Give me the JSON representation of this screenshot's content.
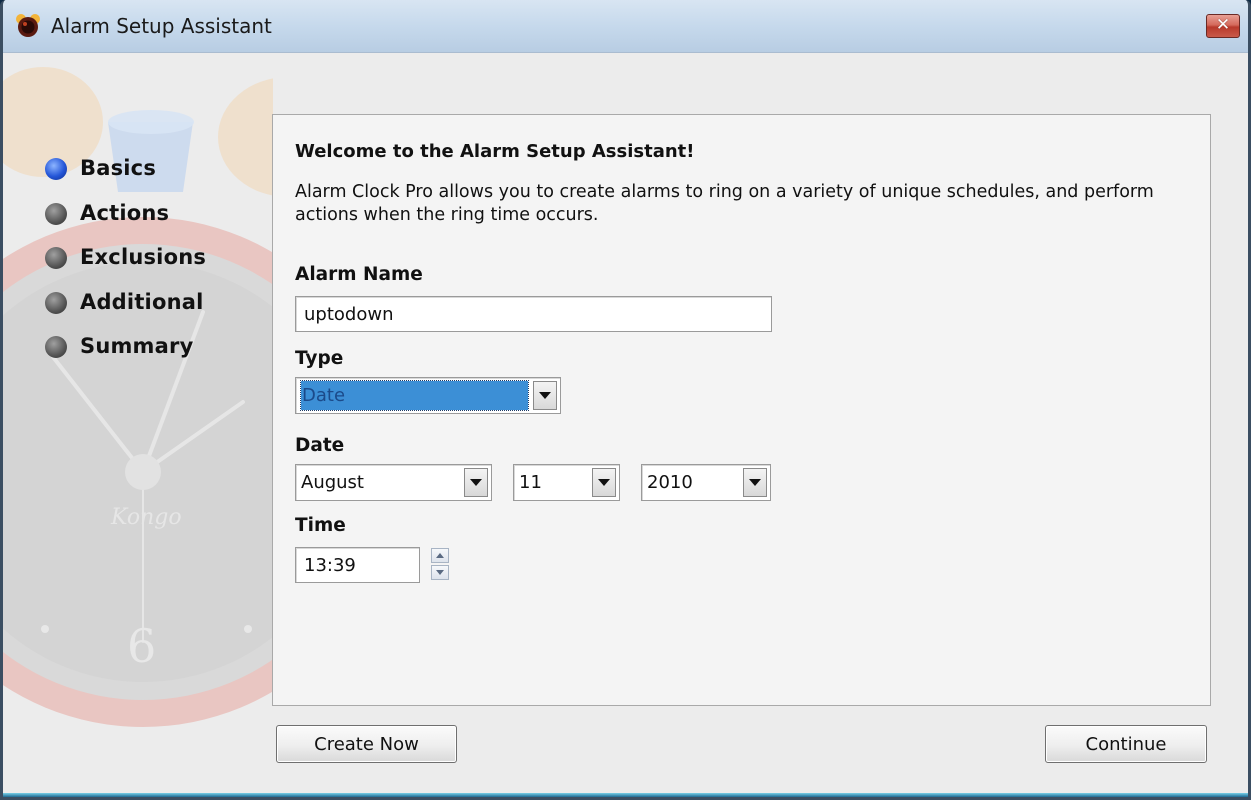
{
  "window": {
    "title": "Alarm Setup Assistant",
    "app_icon": "alarm-clock-icon",
    "close_icon": "close-icon",
    "close_symbol": "✕"
  },
  "sidebar": {
    "steps": [
      {
        "label": "Basics",
        "active": true
      },
      {
        "label": "Actions",
        "active": false
      },
      {
        "label": "Exclusions",
        "active": false
      },
      {
        "label": "Additional",
        "active": false
      },
      {
        "label": "Summary",
        "active": false
      }
    ],
    "background_watermark": {
      "brand": "Kongo",
      "numeral": "6"
    }
  },
  "panel": {
    "heading": "Welcome to the Alarm Setup Assistant!",
    "intro_line1": "Alarm Clock Pro allows you to create alarms to ring on a variety of unique schedules, and perform",
    "intro_line2": "actions when the ring time occurs.",
    "alarm_name": {
      "label": "Alarm Name",
      "value": "uptodown"
    },
    "type": {
      "label": "Type",
      "value": "Date"
    },
    "date": {
      "label": "Date",
      "month": "August",
      "day": "11",
      "year": "2010"
    },
    "time": {
      "label": "Time",
      "value": "13:39"
    }
  },
  "footer": {
    "create_now_label": "Create Now",
    "continue_label": "Continue"
  },
  "colors": {
    "active_step": "#2456d8",
    "selection": "#3c8fd6"
  }
}
